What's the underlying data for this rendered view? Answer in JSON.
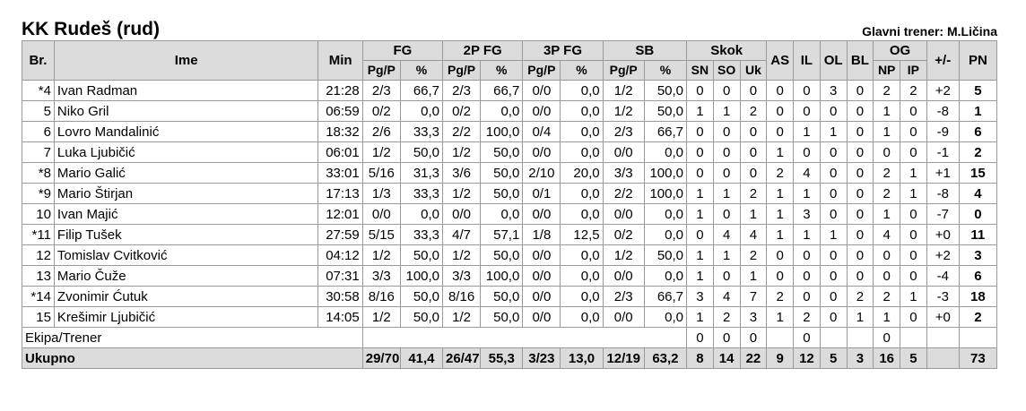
{
  "team": {
    "title": "KK Rudeš (rud)",
    "coach": "Glavni trener: M.Ličina"
  },
  "headers": {
    "group": [
      "FG",
      "2P FG",
      "3P FG",
      "SB",
      "Skok",
      "OG"
    ],
    "br": "Br.",
    "ime": "Ime",
    "min": "Min",
    "pgp": "Pg/P",
    "pct": "%",
    "sn": "SN",
    "so": "SO",
    "uk": "Uk",
    "as": "AS",
    "il": "IL",
    "ol": "OL",
    "bl": "BL",
    "np": "NP",
    "ip": "IP",
    "pm": "+/-",
    "pn": "PN"
  },
  "players": [
    [
      "*4",
      "Ivan Radman",
      "21:28",
      "2/3",
      "66,7",
      "2/3",
      "66,7",
      "0/0",
      "0,0",
      "1/2",
      "50,0",
      "0",
      "0",
      "0",
      "0",
      "0",
      "3",
      "0",
      "2",
      "2",
      "+2",
      "5"
    ],
    [
      "5",
      "Niko Gril",
      "06:59",
      "0/2",
      "0,0",
      "0/2",
      "0,0",
      "0/0",
      "0,0",
      "1/2",
      "50,0",
      "1",
      "1",
      "2",
      "0",
      "0",
      "0",
      "0",
      "1",
      "0",
      "-8",
      "1"
    ],
    [
      "6",
      "Lovro Mandalinić",
      "18:32",
      "2/6",
      "33,3",
      "2/2",
      "100,0",
      "0/4",
      "0,0",
      "2/3",
      "66,7",
      "0",
      "0",
      "0",
      "0",
      "1",
      "1",
      "0",
      "1",
      "0",
      "-9",
      "6"
    ],
    [
      "7",
      "Luka Ljubičić",
      "06:01",
      "1/2",
      "50,0",
      "1/2",
      "50,0",
      "0/0",
      "0,0",
      "0/0",
      "0,0",
      "0",
      "0",
      "0",
      "1",
      "0",
      "0",
      "0",
      "0",
      "0",
      "-1",
      "2"
    ],
    [
      "*8",
      "Mario Galić",
      "33:01",
      "5/16",
      "31,3",
      "3/6",
      "50,0",
      "2/10",
      "20,0",
      "3/3",
      "100,0",
      "0",
      "0",
      "0",
      "2",
      "4",
      "0",
      "0",
      "2",
      "1",
      "+1",
      "15"
    ],
    [
      "*9",
      "Mario Štirjan",
      "17:13",
      "1/3",
      "33,3",
      "1/2",
      "50,0",
      "0/1",
      "0,0",
      "2/2",
      "100,0",
      "1",
      "1",
      "2",
      "1",
      "1",
      "0",
      "0",
      "2",
      "1",
      "-8",
      "4"
    ],
    [
      "10",
      "Ivan Majić",
      "12:01",
      "0/0",
      "0,0",
      "0/0",
      "0,0",
      "0/0",
      "0,0",
      "0/0",
      "0,0",
      "1",
      "0",
      "1",
      "1",
      "3",
      "0",
      "0",
      "1",
      "0",
      "-7",
      "0"
    ],
    [
      "*11",
      "Filip Tušek",
      "27:59",
      "5/15",
      "33,3",
      "4/7",
      "57,1",
      "1/8",
      "12,5",
      "0/2",
      "0,0",
      "0",
      "4",
      "4",
      "1",
      "1",
      "1",
      "0",
      "4",
      "0",
      "+0",
      "11"
    ],
    [
      "12",
      "Tomislav Cvitković",
      "04:12",
      "1/2",
      "50,0",
      "1/2",
      "50,0",
      "0/0",
      "0,0",
      "1/2",
      "50,0",
      "1",
      "1",
      "2",
      "0",
      "0",
      "0",
      "0",
      "0",
      "0",
      "+2",
      "3"
    ],
    [
      "13",
      "Mario Čuže",
      "07:31",
      "3/3",
      "100,0",
      "3/3",
      "100,0",
      "0/0",
      "0,0",
      "0/0",
      "0,0",
      "1",
      "0",
      "1",
      "0",
      "0",
      "0",
      "0",
      "0",
      "0",
      "-4",
      "6"
    ],
    [
      "*14",
      "Zvonimir Ćutuk",
      "30:58",
      "8/16",
      "50,0",
      "8/16",
      "50,0",
      "0/0",
      "0,0",
      "2/3",
      "66,7",
      "3",
      "4",
      "7",
      "2",
      "0",
      "0",
      "2",
      "2",
      "1",
      "-3",
      "18"
    ],
    [
      "15",
      "Krešimir Ljubičić",
      "14:05",
      "1/2",
      "50,0",
      "1/2",
      "50,0",
      "0/0",
      "0,0",
      "0/0",
      "0,0",
      "1",
      "2",
      "3",
      "1",
      "2",
      "0",
      "1",
      "1",
      "0",
      "+0",
      "2"
    ]
  ],
  "team_row": {
    "label": "Ekipa/Trener",
    "sn": "0",
    "so": "0",
    "uk": "0",
    "il": "0",
    "np": "0"
  },
  "total": {
    "label": "Ukupno",
    "fg": "29/70",
    "fg_pct": "41,4",
    "p2": "26/47",
    "p2_pct": "55,3",
    "p3": "3/23",
    "p3_pct": "13,0",
    "ft": "12/19",
    "ft_pct": "63,2",
    "sn": "8",
    "so": "14",
    "uk": "22",
    "as": "9",
    "il": "12",
    "ol": "5",
    "bl": "3",
    "np": "16",
    "ip": "5",
    "pm": "",
    "pn": "73"
  }
}
